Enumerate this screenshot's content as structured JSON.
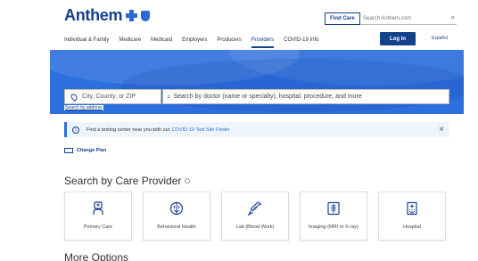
{
  "header": {
    "logo_text": "Anthem",
    "find_care": "Find Care",
    "search_placeholder": "Search Anthem.com",
    "login": "Log In",
    "language": "Español"
  },
  "nav": {
    "items": [
      "Individual & Family",
      "Medicare",
      "Medicaid",
      "Employers",
      "Producers",
      "Providers",
      "COVID-19 Info"
    ],
    "active_index": 5
  },
  "search": {
    "location_placeholder": "City, County, or ZIP",
    "query_placeholder": "Search by doctor (name or specialty), hospital, procedure, and more",
    "search_by_address": "Search by address"
  },
  "notice": {
    "text_before": "Find a testing center near you with our",
    "link_text": "COVID-19 Test Site Finder"
  },
  "change_plan": "Change Plan",
  "section_title": "Search by Care Provider",
  "cards": [
    {
      "label": "Primary Care",
      "icon": "doctor-icon"
    },
    {
      "label": "Behavioral Health",
      "icon": "brain-icon"
    },
    {
      "label": "Lab (Blood Work)",
      "icon": "syringe-icon"
    },
    {
      "label": "Imaging (MRI or X-ray)",
      "icon": "xray-icon"
    },
    {
      "label": "Hospital",
      "icon": "hospital-icon"
    }
  ],
  "more_options": "More Options",
  "colors": {
    "brand": "#14418b",
    "hero": "#2d6fde"
  }
}
